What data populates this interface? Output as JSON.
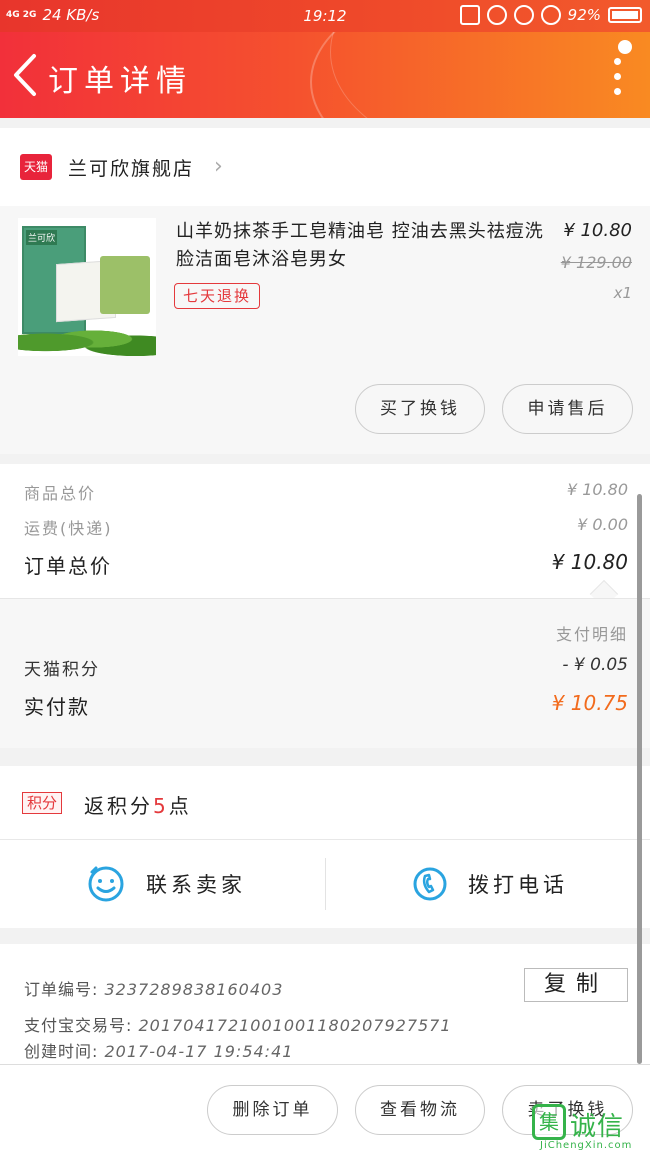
{
  "status_bar": {
    "network": "4G 2G",
    "speed": "24 KB/s",
    "time": "19:12",
    "battery": "92%"
  },
  "header": {
    "title": "订单详情"
  },
  "store": {
    "platform_badge": "天猫",
    "name": "兰可欣旗舰店"
  },
  "product": {
    "brand_label": "兰可欣",
    "title": "山羊奶抹茶手工皂精油皂 控油去黑头祛痘洗脸洁面皂沐浴皂男女",
    "badge": "七天退换",
    "price": "¥ 10.80",
    "original_price": "¥ 129.00",
    "quantity": "x1",
    "buttons": {
      "buy_again": "买了换钱",
      "after_sale": "申请售后"
    }
  },
  "totals": {
    "goods_total_label": "商品总价",
    "goods_total_value": "¥ 10.80",
    "shipping_label": "运费(快递)",
    "shipping_value": "¥ 0.00",
    "order_total_label": "订单总价",
    "order_total_value": "¥ 10.80"
  },
  "payment": {
    "detail_label": "支付明细",
    "points_label": "天猫积分",
    "points_value": "- ¥ 0.05",
    "paid_label": "实付款",
    "paid_value": "¥ 10.75"
  },
  "rebate": {
    "badge": "积分",
    "text_prefix": "返积分",
    "points": "5",
    "text_suffix": "点"
  },
  "contact": {
    "seller_label": "联系卖家",
    "phone_label": "拨打电话"
  },
  "order_info": {
    "order_no_label": "订单编号:",
    "order_no": "3237289838160403",
    "copy_label": "复制",
    "alipay_label": "支付宝交易号:",
    "alipay_no": "2017041721001001180207927571",
    "created_label": "创建时间:",
    "created_time": "2017-04-17 19:54:41"
  },
  "bottom_bar": {
    "delete": "删除订单",
    "logistics": "查看物流",
    "buy_again": "卖了换钱"
  },
  "watermark": {
    "logo_char": "集",
    "text": "诚信",
    "url": "JiChengXin.com"
  },
  "colors": {
    "accent_red": "#e4393c",
    "paid_orange": "#f26b1d",
    "contact_blue": "#2aa4e0"
  }
}
